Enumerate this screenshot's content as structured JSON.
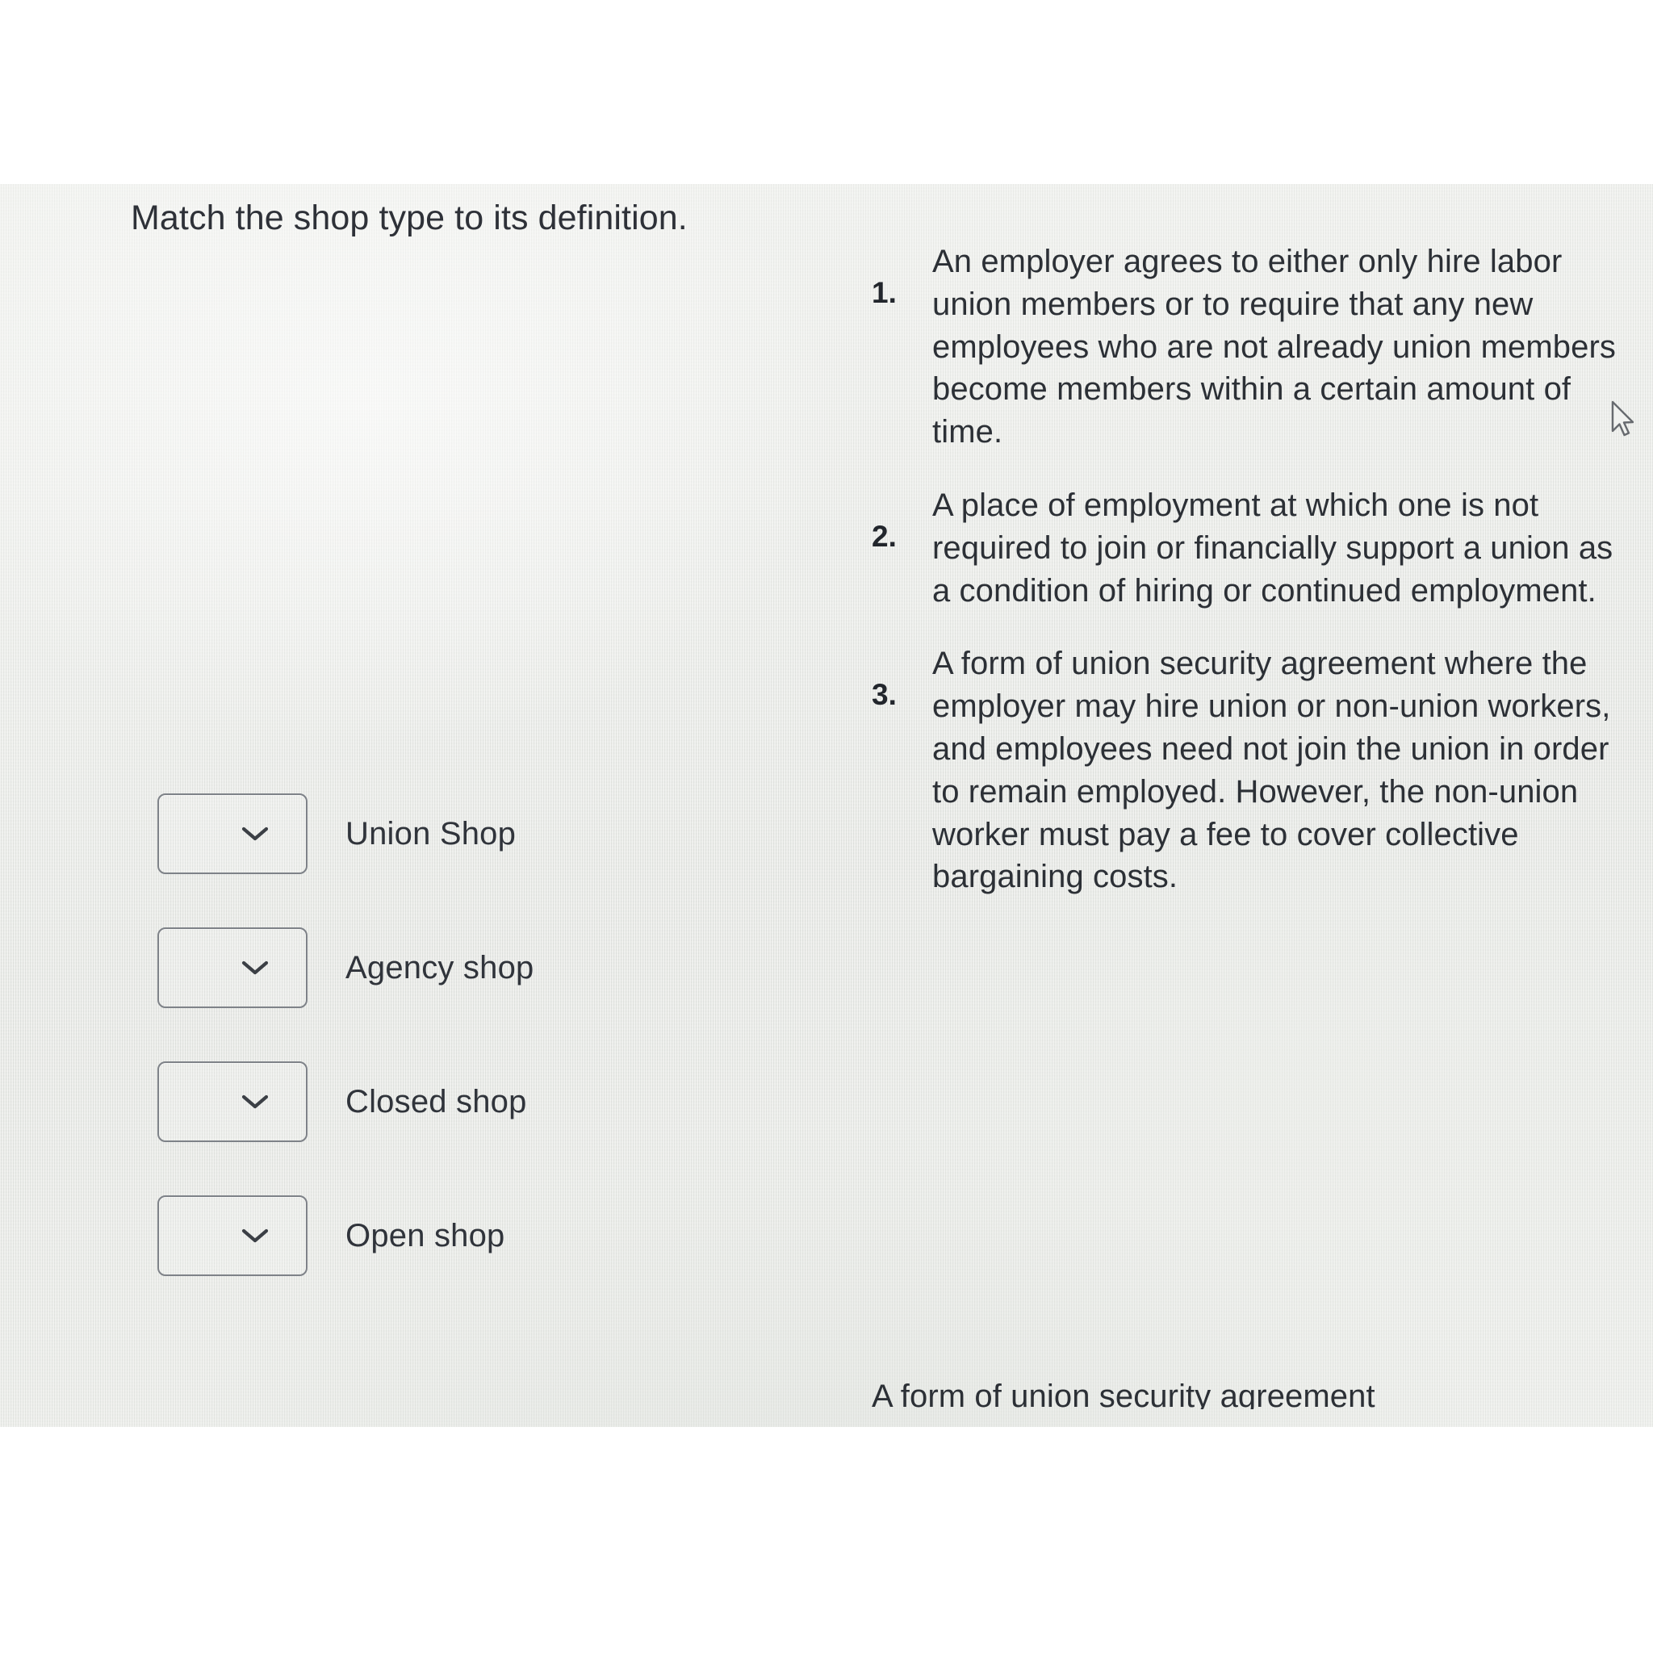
{
  "prompt": {
    "title": "Match the shop type to its definition."
  },
  "match_rows": [
    {
      "dropdown_value": "",
      "dropdown_icon": "chevron-down-icon",
      "label": "Union Shop"
    },
    {
      "dropdown_value": "",
      "dropdown_icon": "chevron-down-icon",
      "label": "Agency shop"
    },
    {
      "dropdown_value": "",
      "dropdown_icon": "chevron-down-icon",
      "label": "Closed shop"
    },
    {
      "dropdown_value": "",
      "dropdown_icon": "chevron-down-icon",
      "label": "Open shop"
    }
  ],
  "definitions": [
    {
      "number": "1.",
      "text": "An employer agrees to either only hire labor union members or to require that any new employees who are not already union members become members within a certain amount of time."
    },
    {
      "number": "2.",
      "text": "A place of employment at which one is not required to join or financially support a union as a condition of hiring or continued employment."
    },
    {
      "number": "3.",
      "text": "A form of union security agreement where the employer may hire union or non-union workers, and employees need not join the union in order to remain employed. However, the non-union worker must pay a fee to cover collective bargaining costs."
    }
  ],
  "clipped_definition": {
    "text": "A form of union security agreement"
  },
  "cursor": {
    "icon": "mouse-pointer-icon"
  },
  "colors": {
    "screen_background": "#e9eae7",
    "text": "#2c3036",
    "border": "#7e8288",
    "page_background": "#ffffff"
  }
}
